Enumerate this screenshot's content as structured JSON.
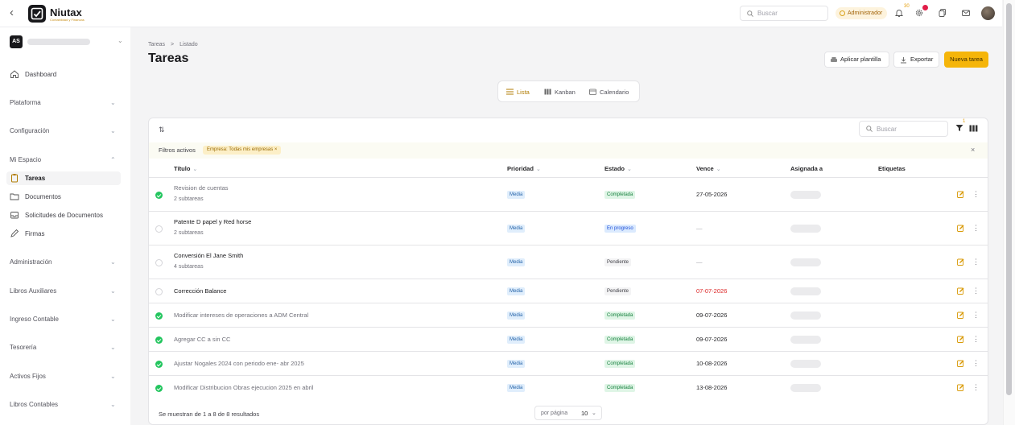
{
  "topbar": {
    "brand": "Niutax",
    "brand_sub": "Contabilidad y Finanzas",
    "search_placeholder": "Buscar",
    "role_badge": "Administrador",
    "notif_count": "30"
  },
  "sidebar": {
    "org_initials": "AS",
    "dashboard": "Dashboard",
    "sections": [
      "Plataforma",
      "Configuración",
      "Mi Espacio"
    ],
    "my_space_items": [
      "Tareas",
      "Documentos",
      "Solicitudes de Documentos",
      "Firmas"
    ],
    "lower_sections": [
      "Administración",
      "Libros Auxiliares",
      "Ingreso Contable",
      "Tesorería",
      "Activos Fijos",
      "Libros Contables"
    ]
  },
  "breadcrumb": {
    "first": "Tareas",
    "sep": ">",
    "second": "Listado"
  },
  "page_title": "Tareas",
  "actions": {
    "template": "Aplicar plantilla",
    "export": "Exportar",
    "new_task": "Nueva tarea"
  },
  "views": {
    "list": "Lista",
    "kanban": "Kanban",
    "calendar": "Calendario"
  },
  "table": {
    "search_placeholder": "Buscar",
    "filter_count": "1",
    "filters_label": "Filtros activos",
    "filter_chip": "Empresa: Todas mis empresas ×",
    "headers": {
      "title": "Título",
      "priority": "Prioridad",
      "status": "Estado",
      "due": "Vence",
      "assigned": "Asignada a",
      "tags": "Etiquetas"
    },
    "rows": [
      {
        "title": "Revision de cuentas",
        "subtasks": "2 subtareas",
        "priority": "Media",
        "status": "Completada",
        "due": "27-05-2026"
      },
      {
        "title": "Patente D papel y Red horse",
        "subtasks": "2 subtareas",
        "priority": "Media",
        "status": "En progreso",
        "due": "—"
      },
      {
        "title": "Conversión El Jane Smith",
        "subtasks": "4 subtareas",
        "priority": "Media",
        "status": "Pendiente",
        "due": "—"
      },
      {
        "title": "Corrección Balance",
        "subtasks": "",
        "priority": "Media",
        "status": "Pendiente",
        "due": "07-07-2026"
      },
      {
        "title": "Modificar intereses de operaciones a ADM Central",
        "subtasks": "",
        "priority": "Media",
        "status": "Completada",
        "due": "09-07-2026"
      },
      {
        "title": "Agregar CC a sin CC",
        "subtasks": "",
        "priority": "Media",
        "status": "Completada",
        "due": "09-07-2026"
      },
      {
        "title": "Ajustar Nogales 2024 con periodo ene- abr 2025",
        "subtasks": "",
        "priority": "Media",
        "status": "Completada",
        "due": "10-08-2026"
      },
      {
        "title": "Modificar Distribucion Obras ejecucion 2025 en abril",
        "subtasks": "",
        "priority": "Media",
        "status": "Completada",
        "due": "13-08-2026"
      }
    ],
    "results_text": "Se muestran de 1 a 8 de 8 resultados",
    "per_page_label": "por página",
    "per_page_value": "10"
  },
  "colors": {
    "accent": "#f5b50a",
    "done": "#22c55e",
    "overdue": "#dc2626"
  }
}
